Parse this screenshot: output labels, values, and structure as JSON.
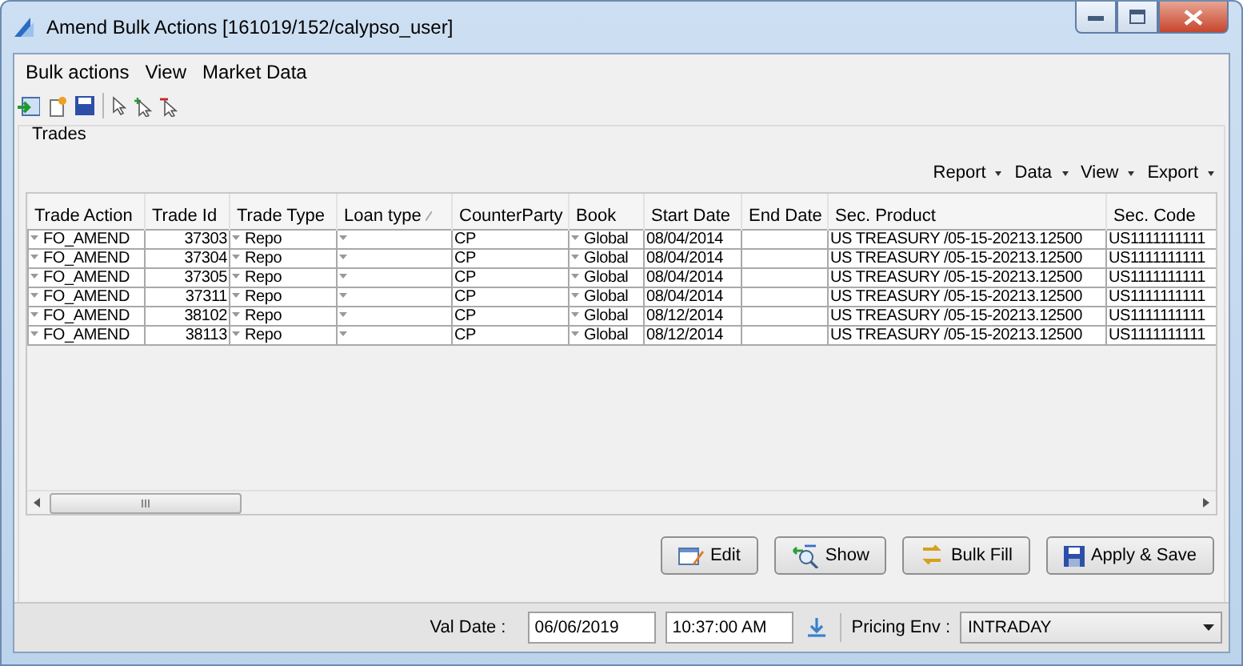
{
  "window": {
    "title": "Amend Bulk Actions [161019/152/calypso_user]"
  },
  "menu": [
    "Bulk actions",
    "View",
    "Market Data"
  ],
  "section": {
    "title": "Trades"
  },
  "table_menu": [
    "Report",
    "Data",
    "View",
    "Export"
  ],
  "table": {
    "columns": [
      {
        "label": "Trade Action",
        "kind": "dropdown",
        "sorted": false
      },
      {
        "label": "Trade Id",
        "kind": "number",
        "sorted": false
      },
      {
        "label": "Trade Type",
        "kind": "dropdown",
        "sorted": false
      },
      {
        "label": "Loan type",
        "kind": "dropdown",
        "sorted": true
      },
      {
        "label": "CounterParty",
        "kind": "text",
        "sorted": false
      },
      {
        "label": "Book",
        "kind": "dropdown",
        "sorted": false
      },
      {
        "label": "Start Date",
        "kind": "text",
        "sorted": false
      },
      {
        "label": "End Date",
        "kind": "text",
        "sorted": false
      },
      {
        "label": "Sec. Product",
        "kind": "text",
        "sorted": false
      },
      {
        "label": "Sec. Code",
        "kind": "text",
        "sorted": false
      }
    ],
    "rows": [
      [
        "FO_AMEND",
        "37303",
        "Repo",
        "",
        "CP",
        "Global",
        "08/04/2014",
        "",
        "US TREASURY /05-15-20213.12500",
        "US1111111111"
      ],
      [
        "FO_AMEND",
        "37304",
        "Repo",
        "",
        "CP",
        "Global",
        "08/04/2014",
        "",
        "US TREASURY /05-15-20213.12500",
        "US1111111111"
      ],
      [
        "FO_AMEND",
        "37305",
        "Repo",
        "",
        "CP",
        "Global",
        "08/04/2014",
        "",
        "US TREASURY /05-15-20213.12500",
        "US1111111111"
      ],
      [
        "FO_AMEND",
        "37311",
        "Repo",
        "",
        "CP",
        "Global",
        "08/04/2014",
        "",
        "US TREASURY /05-15-20213.12500",
        "US1111111111"
      ],
      [
        "FO_AMEND",
        "38102",
        "Repo",
        "",
        "CP",
        "Global",
        "08/12/2014",
        "",
        "US TREASURY /05-15-20213.12500",
        "US1111111111"
      ],
      [
        "FO_AMEND",
        "38113",
        "Repo",
        "",
        "CP",
        "Global",
        "08/12/2014",
        "",
        "US TREASURY /05-15-20213.12500",
        "US1111111111"
      ]
    ]
  },
  "buttons": [
    {
      "label": "Edit",
      "kind": "edit"
    },
    {
      "label": "Show",
      "kind": "show"
    },
    {
      "label": "Bulk Fill",
      "kind": "fill"
    },
    {
      "label": "Apply & Save",
      "kind": "save"
    }
  ],
  "status_bar": {
    "val_date_label": "Val Date :",
    "date": "06/06/2019",
    "time": "10:37:00 AM",
    "pricing_env_label": "Pricing Env :",
    "pricing_env": "INTRADAY"
  }
}
